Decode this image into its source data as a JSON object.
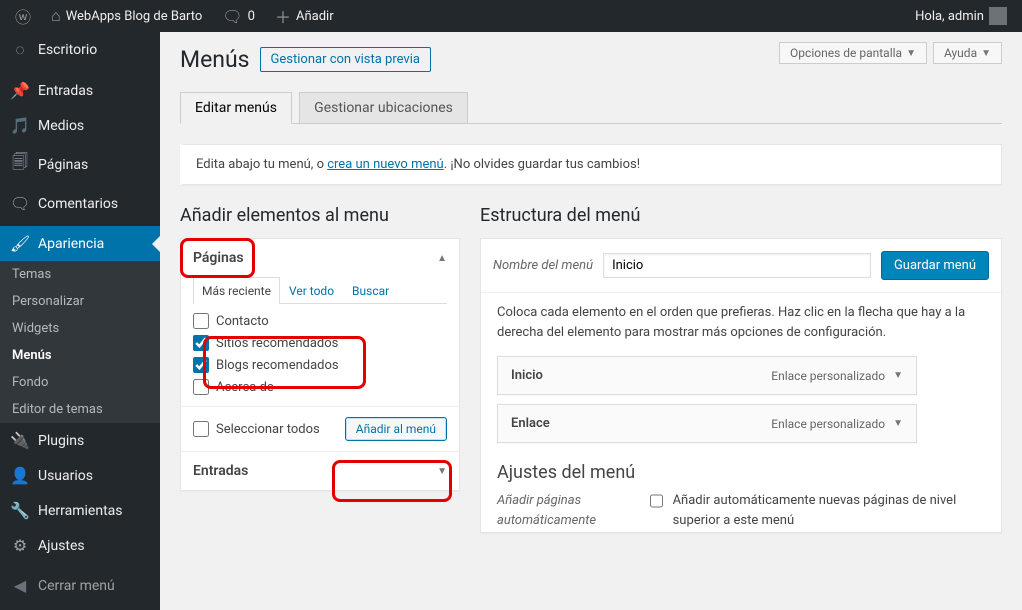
{
  "adminbar": {
    "site_title": "WebApps Blog de Barto",
    "comments": "0",
    "add": "Añadir",
    "greeting": "Hola, admin"
  },
  "sidebar": {
    "dashboard": "Escritorio",
    "posts": "Entradas",
    "media": "Medios",
    "pages": "Páginas",
    "comments": "Comentarios",
    "appearance": "Apariencia",
    "appearance_sub": {
      "themes": "Temas",
      "customize": "Personalizar",
      "widgets": "Widgets",
      "menus": "Menús",
      "background": "Fondo",
      "editor": "Editor de temas"
    },
    "plugins": "Plugins",
    "users": "Usuarios",
    "tools": "Herramientas",
    "settings": "Ajustes",
    "collapse": "Cerrar menú"
  },
  "top_actions": {
    "screen_options": "Opciones de pantalla",
    "help": "Ayuda"
  },
  "heading": {
    "title": "Menús",
    "preview": "Gestionar con vista previa"
  },
  "tabs": {
    "edit": "Editar menús",
    "locations": "Gestionar ubicaciones"
  },
  "banner": {
    "pre": "Edita abajo tu menú, o ",
    "link": "crea un nuevo menú",
    "post": ". ¡No olvides guardar tus cambios!"
  },
  "left": {
    "title": "Añadir elementos al menu",
    "pages": "Páginas",
    "inner_tabs": {
      "recent": "Más reciente",
      "all": "Ver todo",
      "search": "Buscar"
    },
    "items": {
      "contacto": "Contacto",
      "sitios": "Sitios recomendados",
      "blogs": "Blogs recomendados",
      "acerca": "Acerca de"
    },
    "select_all": "Seleccionar todos",
    "add_btn": "Añadir al menú",
    "entries": "Entradas"
  },
  "right": {
    "title": "Estructura del menú",
    "name_label": "Nombre del menú",
    "name_value": "Inicio",
    "save": "Guardar menú",
    "instructions": "Coloca cada elemento en el orden que prefieras. Haz clic en la flecha que hay a la derecha del elemento para mostrar más opciones de configuración.",
    "items": [
      {
        "label": "Inicio",
        "type": "Enlace personalizado"
      },
      {
        "label": "Enlace",
        "type": "Enlace personalizado"
      }
    ],
    "settings": {
      "title": "Ajustes del menú",
      "auto_label": "Añadir páginas automáticamente",
      "auto_text": "Añadir automáticamente nuevas páginas de nivel superior a este menú"
    }
  }
}
